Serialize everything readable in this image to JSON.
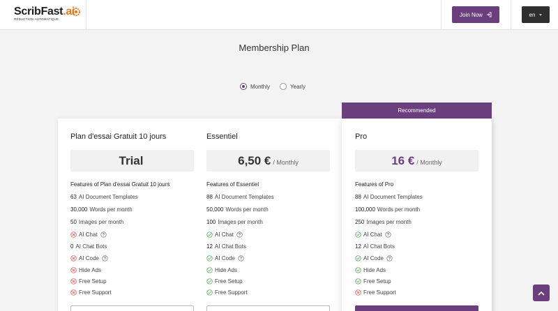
{
  "header": {
    "logo_main": "ScribFast",
    "logo_ai": ".ai",
    "logo_tagline": "RÉDACTION AUTOMATIQUE",
    "join_label": "Join Now",
    "lang_label": "en"
  },
  "page_title": "Membership Plan",
  "billing_toggle": {
    "monthly": "Monthly",
    "yearly": "Yearly",
    "selected": "Monthly"
  },
  "recommended_label": "Recommended",
  "plans": [
    {
      "name": "Plan d'essai Gratuit 10 jours",
      "price": "Trial",
      "period": "",
      "features_heading": "Features of Plan d'essai Gratuit 10 jours",
      "limits": [
        {
          "value": "63",
          "label": "AI Document Templates"
        },
        {
          "value": "30,000",
          "label": "Words per month"
        },
        {
          "value": "50",
          "label": "Images per month"
        }
      ],
      "ai_chat": {
        "label": "AI Chat",
        "status": "no"
      },
      "chat_bots": {
        "value": "0",
        "label": "AI Chat Bots"
      },
      "ai_code": {
        "label": "AI Code",
        "status": "no"
      },
      "flags": [
        {
          "label": "Hide Ads",
          "status": "no"
        },
        {
          "label": "Free Setup",
          "status": "no"
        },
        {
          "label": "Free Support",
          "status": "no"
        }
      ]
    },
    {
      "name": "Essentiel",
      "price": "6,50 €",
      "period": "/ Monthly",
      "features_heading": "Features of Essentiel",
      "limits": [
        {
          "value": "88",
          "label": "AI Document Templates"
        },
        {
          "value": "50,000",
          "label": "Words per month"
        },
        {
          "value": "100",
          "label": "Images per month"
        }
      ],
      "ai_chat": {
        "label": "AI Chat",
        "status": "yes"
      },
      "chat_bots": {
        "value": "12",
        "label": "AI Chat Bots"
      },
      "ai_code": {
        "label": "AI Code",
        "status": "yes"
      },
      "flags": [
        {
          "label": "Hide Ads",
          "status": "yes"
        },
        {
          "label": "Free Setup",
          "status": "yes"
        },
        {
          "label": "Free Support",
          "status": "yes"
        }
      ]
    },
    {
      "name": "Pro",
      "price": "16 €",
      "period": "/ Monthly",
      "features_heading": "Features of Pro",
      "limits": [
        {
          "value": "88",
          "label": "AI Document Templates"
        },
        {
          "value": "100,000",
          "label": "Words per month"
        },
        {
          "value": "250",
          "label": "Images per month"
        }
      ],
      "ai_chat": {
        "label": "AI Chat",
        "status": "yes"
      },
      "chat_bots": {
        "value": "12",
        "label": "AI Chat Bots"
      },
      "ai_code": {
        "label": "AI Code",
        "status": "yes"
      },
      "flags": [
        {
          "label": "Hide Ads",
          "status": "yes"
        },
        {
          "label": "Free Setup",
          "status": "yes"
        },
        {
          "label": "Free Support",
          "status": "no"
        }
      ]
    }
  ],
  "colors": {
    "brand": "#6b3f7e",
    "yes": "#4caf50",
    "no": "#e05555",
    "logo_accent": "#e47a1e"
  }
}
